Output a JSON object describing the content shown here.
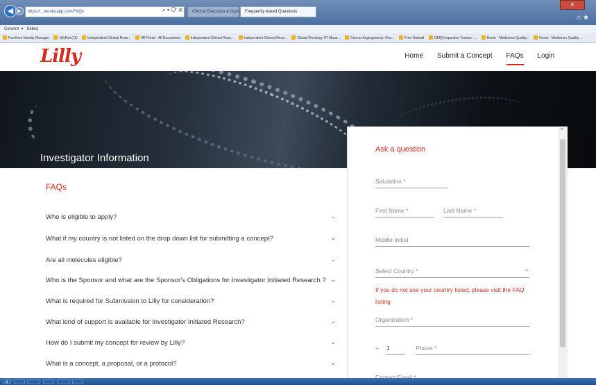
{
  "browser": {
    "url": "https://...herokuapp.com/FAQs",
    "tabs": [
      "Clinical Execution & Optimizat...",
      "Frequently Asked Questions"
    ],
    "command_bar": [
      "Convert",
      "Select"
    ],
    "favorites": [
      "Forefront Identity Manager",
      "LillyNet (11)",
      "Independent Clinical Rese...",
      "IIR Portal - All Documents",
      "Independent Clinical Rese...",
      "Independent Clinical Rese...",
      "Global Oncology IIT Mana...",
      "Cancer Angiogenesis, Onc...",
      "Free Hotmail",
      "GMQ Inspection Tracker -...",
      "Home - Medicines Quality...",
      "Home - Medicines Quality..."
    ]
  },
  "header": {
    "logo": "Lilly",
    "nav": [
      "Home",
      "Submit a Concept",
      "FAQs",
      "Login"
    ]
  },
  "hero": {
    "title": "Investigator Information"
  },
  "faq": {
    "title": "FAQs",
    "items": [
      "Who is eligible to apply?",
      "What if my country is not listed on the drop down list for submitting a concept?",
      "Are all molecules eligible?",
      "Who is the Sponsor and what are the Sponsor's Obligations for Investigator Initiated Research ?",
      "What is required for Submission to Lilly for consideration?",
      "What kind of support is available for Investigator Initiated Research?",
      "How do I submit my concept for review by Lilly?",
      "What is a concept, a proposal, or a protocol?"
    ]
  },
  "form": {
    "title": "Ask a question",
    "salutation": "Salutation *",
    "first_name": "First Name *",
    "last_name": "Last Name *",
    "middle_initial": "Middle Initial",
    "country": "Select Country *",
    "notice": "If you do not see your country listed, please visit the FAQ listing",
    "organization": "Organization *",
    "phone_prefix": "+",
    "phone_code": "1",
    "phone": "Phone *",
    "email": "Contact Email *"
  },
  "colors": {
    "accent": "#d52b1e"
  }
}
